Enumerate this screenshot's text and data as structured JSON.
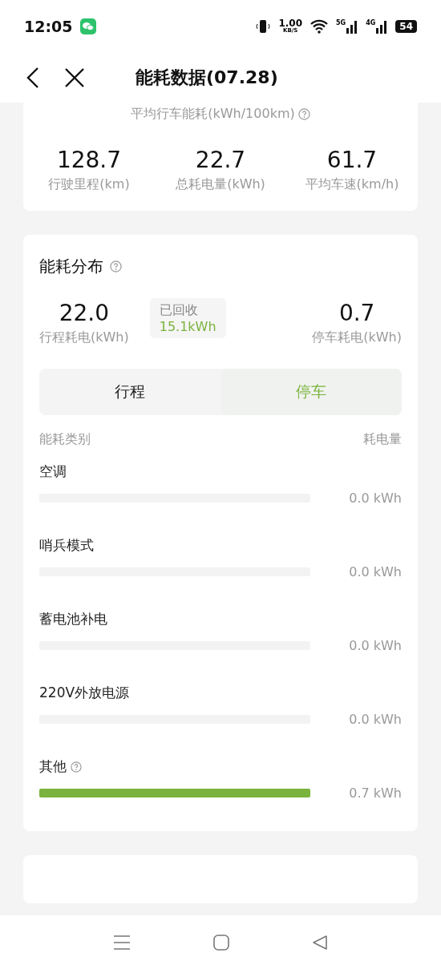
{
  "status_bar": {
    "time": "12:05",
    "net_speed": "1.00",
    "net_unit": "KB/S",
    "sim1": "5G",
    "sim2": "4G",
    "battery": "54"
  },
  "header": {
    "title": "能耗数据(07.28)"
  },
  "summary": {
    "caption": "平均行车能耗(kWh/100km)",
    "stats": [
      {
        "value": "128.7",
        "label": "行驶里程(km)"
      },
      {
        "value": "22.7",
        "label": "总耗电量(kWh)"
      },
      {
        "value": "61.7",
        "label": "平均车速(km/h)"
      }
    ]
  },
  "distribution": {
    "title": "能耗分布",
    "drive": {
      "value": "22.0",
      "label": "行程耗电(kWh)"
    },
    "recovered": {
      "label": "已回收",
      "value": "15.1kWh"
    },
    "park": {
      "value": "0.7",
      "label": "停车耗电(kWh)"
    },
    "tabs": [
      {
        "label": "行程",
        "selected": false
      },
      {
        "label": "停车",
        "selected": true
      }
    ],
    "columns": [
      "能耗类别",
      "耗电量"
    ],
    "items": [
      {
        "name": "空调",
        "help": false,
        "level": 0,
        "reading": "0.0 kWh"
      },
      {
        "name": "哨兵模式",
        "help": false,
        "level": 0,
        "reading": "0.0 kWh"
      },
      {
        "name": "蓄电池补电",
        "help": false,
        "level": 0,
        "reading": "0.0 kWh"
      },
      {
        "name": "220V外放电源",
        "help": false,
        "level": 0,
        "reading": "0.0 kWh"
      },
      {
        "name": "其他",
        "help": true,
        "level": 1,
        "reading": "0.7 kWh"
      }
    ]
  }
}
